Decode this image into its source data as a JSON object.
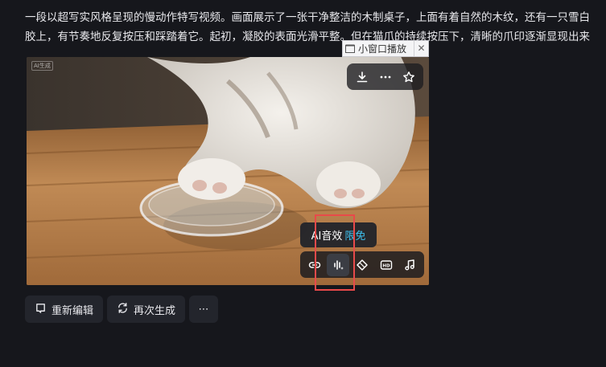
{
  "prompt": {
    "line1": "一段以超写实风格呈现的慢动作特写视频。画面展示了一张干净整洁的木制桌子，上面有着自然的木纹，还有一只雪白",
    "line2": "胶上，有节奏地反复按压和踩踏着它。起初，凝胶的表面光滑平整。但在猫爪的持续按压下，清晰的爪印逐渐显现出来"
  },
  "video": {
    "ai_tag": "AI生成",
    "pip": {
      "label": "小窗口播放",
      "close": "✕"
    },
    "top_actions": [
      "download-icon",
      "more-icon",
      "star-icon"
    ],
    "tooltip": {
      "text": "AI音效",
      "badge": "限免"
    },
    "tools": [
      "loop-icon",
      "ai-sound-icon",
      "diamond-icon",
      "hd-icon",
      "music-icon"
    ]
  },
  "actions": {
    "reedit": "重新编辑",
    "regenerate": "再次生成",
    "more": "⋯"
  },
  "colors": {
    "background": "#16171c",
    "accent": "#3ec3f2",
    "highlight": "#e84a4a"
  }
}
